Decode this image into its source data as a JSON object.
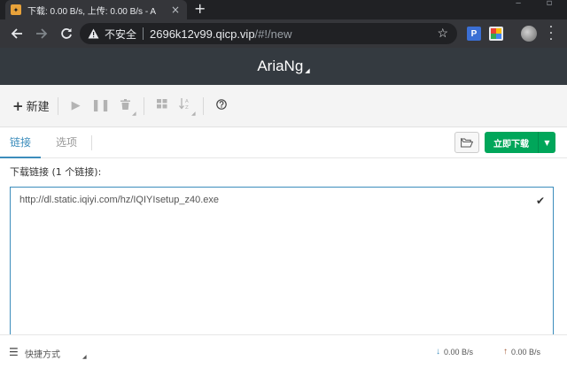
{
  "browser": {
    "tab_title": "下载: 0.00 B/s, 上传: 0.00 B/s - A",
    "tab_close": "×",
    "new_tab": "+",
    "security_label": "不安全",
    "url_host": "2696k12v99.qicp.vip",
    "url_path": "/#!/new",
    "extensions": [
      {
        "name": "P",
        "color": "#3b6fd4"
      },
      {
        "name": "",
        "color": "#e8eaed"
      }
    ]
  },
  "app": {
    "title": "AriaNg",
    "toolbar": {
      "new_label": "新建"
    },
    "tabs": [
      {
        "label": "链接",
        "active": true
      },
      {
        "label": "选项",
        "active": false
      }
    ],
    "download_now_label": "立即下载",
    "links_label": "下载链接 (1 个链接):",
    "links_value": "http://dl.static.iqiyi.com/hz/IQIYIsetup_z40.exe",
    "footer": {
      "shortcut_label": "快捷方式",
      "download_speed": "0.00 B/s",
      "upload_speed": "0.00 B/s"
    },
    "colors": {
      "header_bg": "#343a40",
      "accent": "#3c8dbc",
      "download_button": "#00a65a"
    }
  }
}
